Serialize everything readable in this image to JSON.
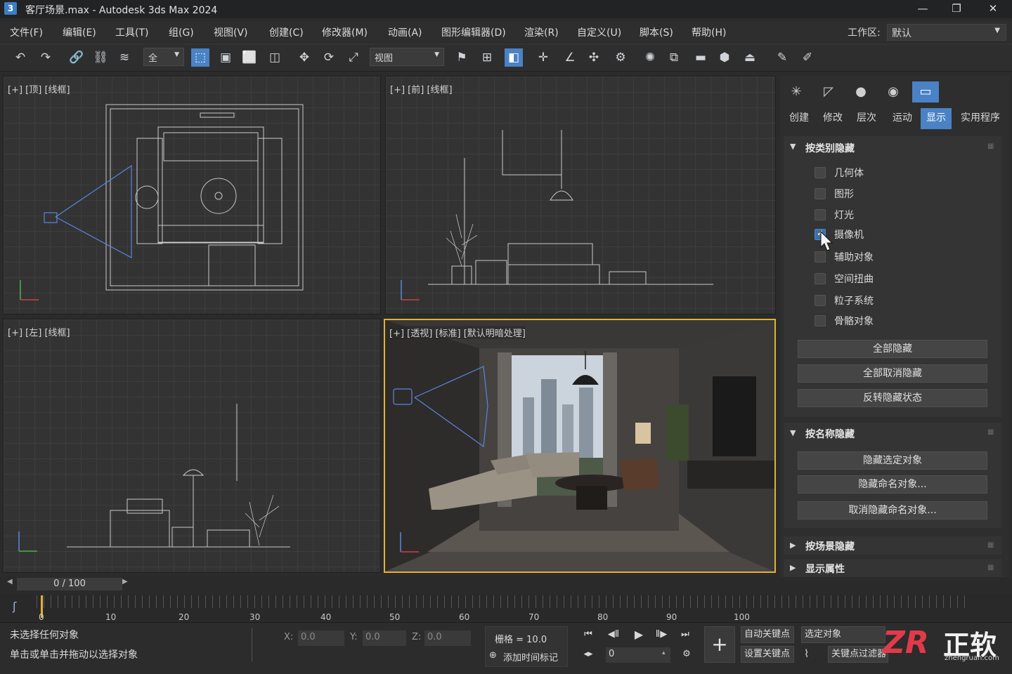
{
  "window": {
    "title": "客厅场景.max - Autodesk 3ds Max 2024",
    "app_icon": "3",
    "minimize": "—",
    "restore": "❐",
    "close": "✕"
  },
  "menu": [
    "文件(F)",
    "编辑(E)",
    "工具(T)",
    "组(G)",
    "视图(V)",
    "创建(C)",
    "修改器(M)",
    "动画(A)",
    "图形编辑器(D)",
    "渲染(R)",
    "自定义(U)",
    "脚本(S)",
    "帮助(H)"
  ],
  "workspace": {
    "label": "工作区:",
    "value": "默认"
  },
  "toolbar": {
    "selection_set": "全",
    "view_dropdown": "视图"
  },
  "viewports": {
    "top": "[+] [顶] [线框]",
    "front": "[+] [前] [线框]",
    "left": "[+] [左] [线框]",
    "perspective": "[+] [透视] [标准] [默认明暗处理]"
  },
  "panel": {
    "categories": [
      "创建",
      "修改",
      "层次",
      "运动",
      "显示",
      "实用程序"
    ],
    "active_category": "显示",
    "hide_by_category": {
      "title": "按类别隐藏",
      "items": [
        {
          "label": "几何体",
          "checked": false
        },
        {
          "label": "图形",
          "checked": false
        },
        {
          "label": "灯光",
          "checked": false
        },
        {
          "label": "摄像机",
          "checked": true
        },
        {
          "label": "辅助对象",
          "checked": false
        },
        {
          "label": "空间扭曲",
          "checked": false
        },
        {
          "label": "粒子系统",
          "checked": false
        },
        {
          "label": "骨骼对象",
          "checked": false
        }
      ],
      "buttons": [
        "全部隐藏",
        "全部取消隐藏",
        "反转隐藏状态"
      ]
    },
    "hide_by_name": {
      "title": "按名称隐藏",
      "buttons": [
        "隐藏选定对象",
        "隐藏命名对象...",
        "取消隐藏命名对象..."
      ]
    },
    "hide_by_hit": "按场景隐藏",
    "display_props": "显示属性"
  },
  "timeline": {
    "slider": "0 / 100",
    "ticks": [
      "0",
      "10",
      "20",
      "30",
      "40",
      "50",
      "60",
      "70",
      "80",
      "90",
      "100"
    ]
  },
  "status": {
    "line1": "未选择任何对象",
    "line2": "单击或单击并拖动以选择对象",
    "x_label": "X:",
    "x": "0.0",
    "y_label": "Y:",
    "y": "0.0",
    "z_label": "Z:",
    "z": "0.0",
    "grid": "栅格 = 10.0",
    "add_time_tag": "添加时间标记",
    "frame": "0",
    "auto_key": "自动关键点",
    "set_key": "设置关键点",
    "selected": "选定对象",
    "key_filters": "关键点过滤器"
  },
  "watermark": {
    "logo": "ZR",
    "text": "正软",
    "url": "zhengruan.com"
  },
  "colors": {
    "accent": "#4a82c5",
    "active_viewport": "#e0b03a",
    "camera": "#5a86e0"
  }
}
